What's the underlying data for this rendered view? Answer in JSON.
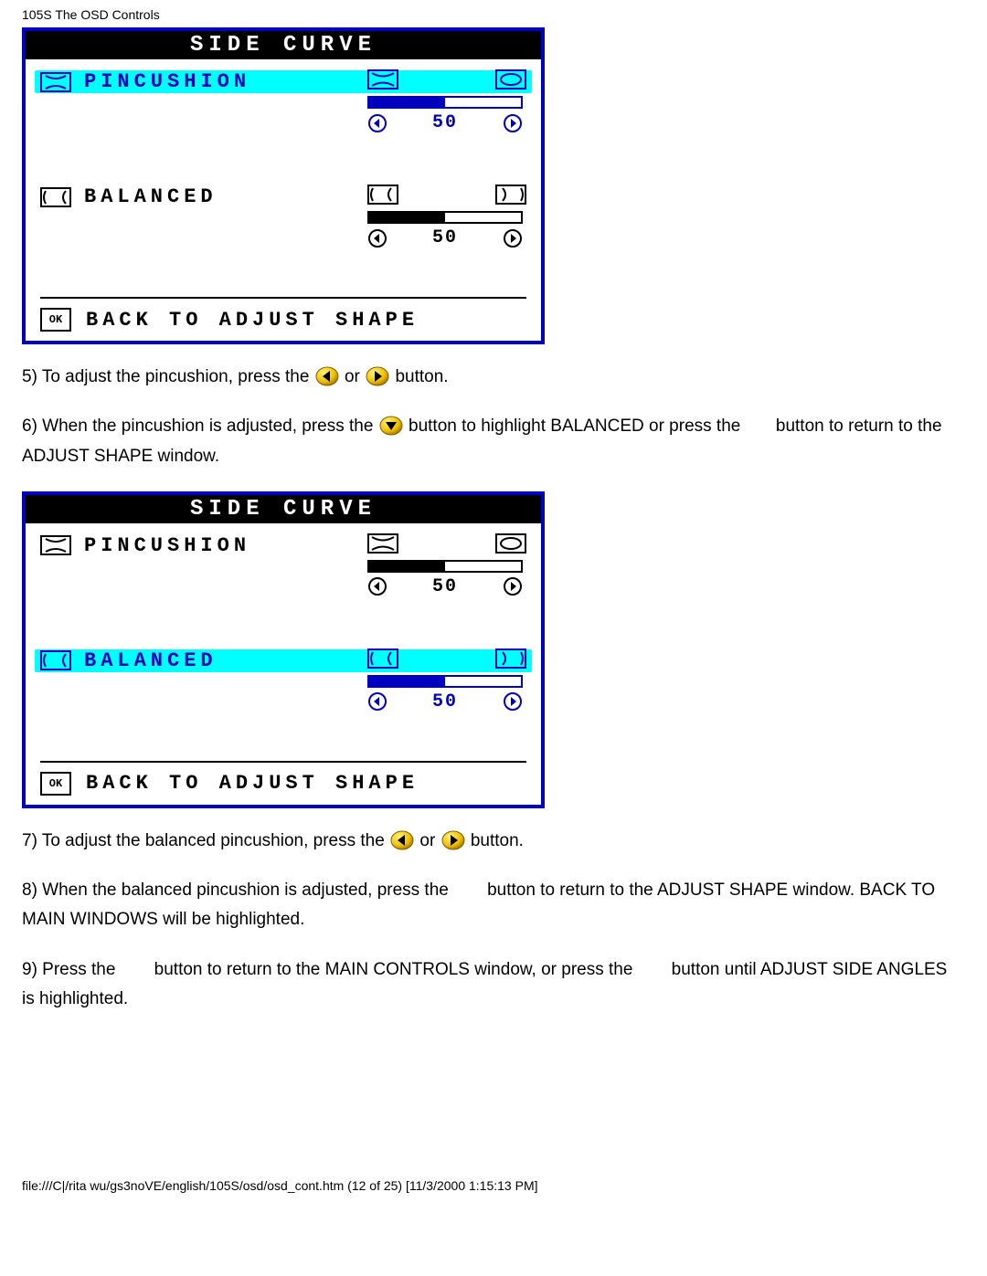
{
  "header": "105S The OSD Controls",
  "osd1": {
    "title": "SIDE CURVE",
    "pincushion": {
      "label": "PINCUSHION",
      "value": "50",
      "fill": 50,
      "selected": true
    },
    "balanced": {
      "label": "BALANCED",
      "value": "50",
      "fill": 50,
      "selected": false
    },
    "back": "BACK TO ADJUST SHAPE"
  },
  "osd2": {
    "title": "SIDE CURVE",
    "pincushion": {
      "label": "PINCUSHION",
      "value": "50",
      "fill": 50,
      "selected": false
    },
    "balanced": {
      "label": "BALANCED",
      "value": "50",
      "fill": 50,
      "selected": true
    },
    "back": "BACK TO ADJUST SHAPE"
  },
  "step5": {
    "a": "5) To adjust the pincushion, press the ",
    "b": " or ",
    "c": " button."
  },
  "step6": {
    "a": "6) When the pincushion is adjusted, press the ",
    "b": " button to highlight BALANCED or press the ",
    "c": " button to return to the ADJUST SHAPE window."
  },
  "step7": {
    "a": "7) To adjust the balanced pincushion, press the ",
    "b": " or ",
    "c": " button."
  },
  "step8": "8) When the balanced pincushion is adjusted, press the        button to return to the ADJUST SHAPE window. BACK TO MAIN WINDOWS will be highlighted.",
  "step9": "9) Press the        button to return to the MAIN CONTROLS window, or press the        button until ADJUST SIDE ANGLES is highlighted.",
  "footer": "file:///C|/rita wu/gs3noVE/english/105S/osd/osd_cont.htm (12 of 25) [11/3/2000 1:15:13 PM]"
}
